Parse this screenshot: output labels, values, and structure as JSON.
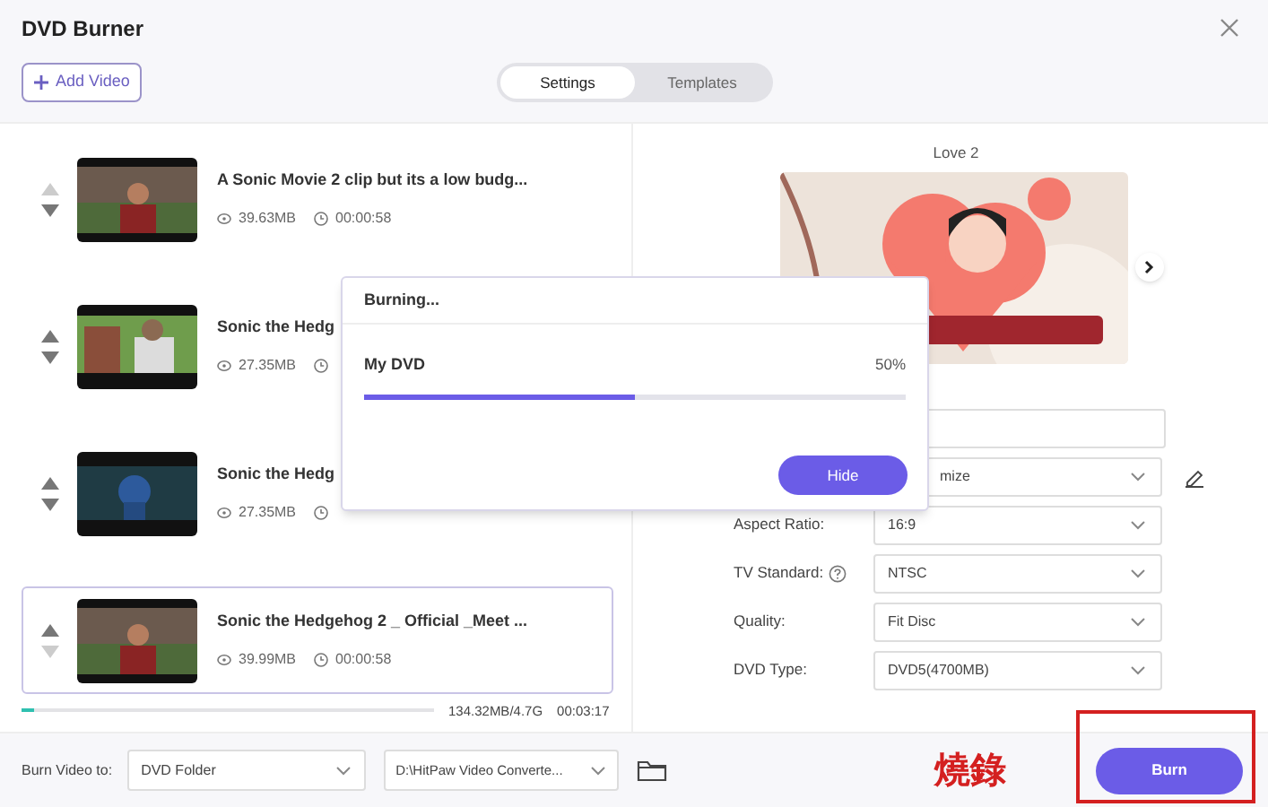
{
  "window": {
    "title": "DVD Burner"
  },
  "add_button": "Add Video",
  "tabs": [
    {
      "label": "Settings",
      "selected": true
    },
    {
      "label": "Templates",
      "selected": false
    }
  ],
  "videos": [
    {
      "title": "A Sonic Movie 2 clip but its a low budg...",
      "size": "39.63MB",
      "duration": "00:00:58",
      "selected": false,
      "up_enabled": false,
      "down_enabled": true
    },
    {
      "title": "Sonic the Hedg",
      "size": "27.35MB",
      "selected": false,
      "up_enabled": true,
      "down_enabled": true
    },
    {
      "title": "Sonic the Hedg",
      "size": "27.35MB",
      "selected": false,
      "up_enabled": true,
      "down_enabled": true
    },
    {
      "title": "Sonic the Hedgehog 2 _ Official _Meet ...",
      "size": "39.99MB",
      "duration": "00:00:58",
      "selected": true,
      "up_enabled": true,
      "down_enabled": false
    }
  ],
  "capacity": {
    "level": 0.03,
    "reading": "134.32MB/4.7G",
    "total_time": "00:03:17"
  },
  "template": {
    "name": "Love 2"
  },
  "settings": [
    {
      "kind": "field"
    },
    {
      "kind": "select",
      "value": "mize",
      "editable": true
    },
    {
      "kind": "select",
      "label": "Aspect Ratio:",
      "value": "16:9"
    },
    {
      "kind": "select",
      "label": "TV Standard:",
      "value": "NTSC",
      "help": true
    },
    {
      "kind": "select",
      "label": "Quality:",
      "value": "Fit Disc"
    },
    {
      "kind": "select",
      "label": "DVD Type:",
      "value": "DVD5(4700MB)"
    }
  ],
  "footer": {
    "label": "Burn Video to:",
    "target": "DVD Folder",
    "path": "D:\\HitPaw Video Converte...",
    "burn_button": "Burn"
  },
  "annotation": {
    "text": "燒錄"
  },
  "dialog": {
    "title": "Burning...",
    "item": "My DVD",
    "percent": "50%",
    "level": 0.5,
    "button": "Hide"
  }
}
